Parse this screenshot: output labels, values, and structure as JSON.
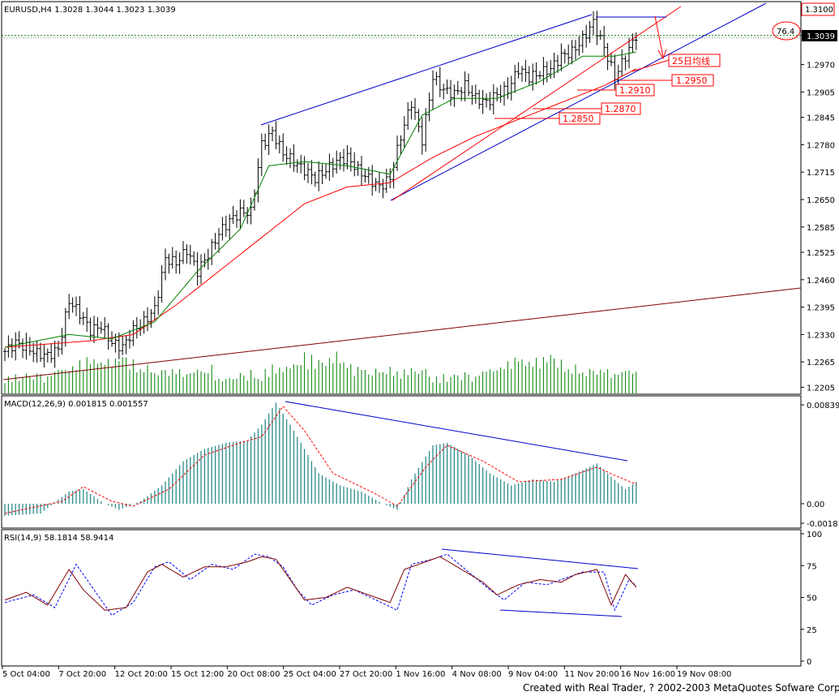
{
  "symbol_header": "EURUSD,H4 1.3028 1.3044 1.3023 1.3039",
  "macd_header": "MACD(12,26,9) 0.001815 0.001557",
  "rsi_header": "RSI(14,9) 58.1814 58.9414",
  "current_price": "1.3039",
  "high_box": "1.3100",
  "marker_value": "76.4",
  "footer": "Created with Real Trader, ? 2002-2003 MetaQuotes Sofware Corp.",
  "annotations": [
    {
      "text": "25日均线"
    },
    {
      "text": "1.2950"
    },
    {
      "text": "1.2910"
    },
    {
      "text": "1.2870"
    },
    {
      "text": "1.2850"
    }
  ],
  "colors": {
    "frame": "#000000",
    "bars": "#000000",
    "volume": "#008000",
    "ma_red": "#ff0000",
    "ma_green": "#008000",
    "channel_blue": "#0000cc",
    "trend_maroon": "#800000",
    "macd_hist": "#2e8b8b",
    "macd_signal": "#ff0000",
    "rsi_line": "#800000",
    "rsi_signal": "#0000ff",
    "annotation": "#ff0000"
  },
  "chart_data": [
    {
      "type": "candlestick",
      "title": "EURUSD,H4",
      "ohlc_last": {
        "open": 1.3028,
        "high": 1.3044,
        "low": 1.3023,
        "close": 1.3039
      },
      "y_ticks": [
        1.31,
        1.3039,
        1.297,
        1.2905,
        1.2845,
        1.278,
        1.2715,
        1.265,
        1.2585,
        1.2525,
        1.246,
        1.2395,
        1.233,
        1.2265,
        1.2205
      ],
      "ylim": [
        1.22,
        1.31
      ],
      "x_ticks": [
        "5 Oct 04:00",
        "7 Oct 20:00",
        "12 Oct 20:00",
        "15 Oct 12:00",
        "20 Oct 08:00",
        "25 Oct 04:00",
        "27 Oct 20:00",
        "1 Nov 16:00",
        "4 Nov 08:00",
        "9 Nov 04:00",
        "11 Nov 20:00",
        "16 Nov 16:00",
        "19 Nov 08:00"
      ],
      "close_path": [
        [
          0,
          1.229
        ],
        [
          3,
          1.231
        ],
        [
          6,
          1.23
        ],
        [
          9,
          1.2285
        ],
        [
          12,
          1.228
        ],
        [
          15,
          1.2295
        ],
        [
          18,
          1.241
        ],
        [
          21,
          1.238
        ],
        [
          24,
          1.234
        ],
        [
          27,
          1.235
        ],
        [
          30,
          1.231
        ],
        [
          33,
          1.23
        ],
        [
          36,
          1.234
        ],
        [
          39,
          1.236
        ],
        [
          42,
          1.239
        ],
        [
          45,
          1.251
        ],
        [
          48,
          1.25
        ],
        [
          51,
          1.253
        ],
        [
          54,
          1.248
        ],
        [
          57,
          1.252
        ],
        [
          60,
          1.257
        ],
        [
          63,
          1.26
        ],
        [
          66,
          1.262
        ],
        [
          69,
          1.262
        ],
        [
          72,
          1.278
        ],
        [
          75,
          1.281
        ],
        [
          78,
          1.276
        ],
        [
          81,
          1.274
        ],
        [
          84,
          1.272
        ],
        [
          87,
          1.27
        ],
        [
          90,
          1.272
        ],
        [
          93,
          1.274
        ],
        [
          96,
          1.275
        ],
        [
          99,
          1.272
        ],
        [
          102,
          1.27
        ],
        [
          105,
          1.268
        ],
        [
          108,
          1.27
        ],
        [
          111,
          1.28
        ],
        [
          114,
          1.288
        ],
        [
          117,
          1.279
        ],
        [
          120,
          1.294
        ],
        [
          123,
          1.291
        ],
        [
          126,
          1.29
        ],
        [
          129,
          1.292
        ],
        [
          132,
          1.289
        ],
        [
          135,
          1.288
        ],
        [
          138,
          1.29
        ],
        [
          141,
          1.291
        ],
        [
          144,
          1.296
        ],
        [
          147,
          1.294
        ],
        [
          150,
          1.295
        ],
        [
          153,
          1.296
        ],
        [
          156,
          1.299
        ],
        [
          159,
          1.3
        ],
        [
          162,
          1.303
        ],
        [
          165,
          1.307
        ],
        [
          168,
          1.301
        ],
        [
          171,
          1.294
        ],
        [
          174,
          1.299
        ],
        [
          177,
          1.3039
        ]
      ],
      "ma_red_path": [
        [
          0,
          1.23
        ],
        [
          24,
          1.2315
        ],
        [
          36,
          1.233
        ],
        [
          48,
          1.24
        ],
        [
          60,
          1.248
        ],
        [
          72,
          1.256
        ],
        [
          84,
          1.264
        ],
        [
          96,
          1.268
        ],
        [
          108,
          1.269
        ],
        [
          120,
          1.275
        ],
        [
          132,
          1.28
        ],
        [
          144,
          1.284
        ],
        [
          156,
          1.288
        ],
        [
          168,
          1.292
        ],
        [
          177,
          1.296
        ]
      ],
      "ma_green_path": [
        [
          0,
          1.23
        ],
        [
          18,
          1.233
        ],
        [
          30,
          1.232
        ],
        [
          42,
          1.236
        ],
        [
          54,
          1.248
        ],
        [
          66,
          1.258
        ],
        [
          74,
          1.273
        ],
        [
          84,
          1.274
        ],
        [
          96,
          1.273
        ],
        [
          108,
          1.271
        ],
        [
          117,
          1.285
        ],
        [
          126,
          1.289
        ],
        [
          138,
          1.289
        ],
        [
          150,
          1.293
        ],
        [
          162,
          1.299
        ],
        [
          171,
          1.299
        ],
        [
          177,
          1.3
        ]
      ],
      "volume_relative": [
        0.3,
        0.35,
        0.3,
        0.4,
        0.3,
        0.35,
        0.45,
        0.4,
        0.3,
        0.5,
        0.4,
        0.3,
        0.35,
        0.5,
        0.45,
        0.6,
        0.5,
        0.55,
        0.5,
        0.6,
        0.55,
        0.7,
        0.6,
        0.75,
        0.85,
        0.7,
        0.8,
        0.65,
        0.7,
        0.75,
        0.6,
        0.8,
        0.7,
        0.9,
        0.75,
        0.65,
        0.7,
        0.6,
        0.5,
        0.55,
        0.6,
        0.5,
        0.45,
        0.4,
        0.55,
        0.5,
        0.45,
        0.5,
        0.55,
        0.5,
        0.45,
        0.4,
        0.5,
        0.45,
        0.55,
        0.5,
        0.45,
        0.5,
        0.6,
        0.35
      ]
    },
    {
      "type": "bar",
      "title": "MACD(12,26,9)",
      "series": [
        {
          "name": "MACD"
        },
        {
          "name": "Signal"
        }
      ],
      "y_ticks": [
        "0.00839",
        "0.00",
        "-0.0018"
      ],
      "ylim": [
        -0.0018,
        0.00839
      ],
      "histogram_path": [
        [
          0,
          -0.001
        ],
        [
          10,
          -0.0008
        ],
        [
          18,
          0.001
        ],
        [
          22,
          0.0012
        ],
        [
          28,
          0.0
        ],
        [
          32,
          -0.0005
        ],
        [
          38,
          0.0002
        ],
        [
          44,
          0.0015
        ],
        [
          50,
          0.0035
        ],
        [
          56,
          0.0045
        ],
        [
          62,
          0.005
        ],
        [
          68,
          0.0052
        ],
        [
          72,
          0.0065
        ],
        [
          76,
          0.0083
        ],
        [
          80,
          0.0065
        ],
        [
          84,
          0.0045
        ],
        [
          88,
          0.0025
        ],
        [
          94,
          0.0015
        ],
        [
          100,
          0.001
        ],
        [
          106,
          0.0
        ],
        [
          110,
          -0.0005
        ],
        [
          114,
          0.002
        ],
        [
          120,
          0.0048
        ],
        [
          124,
          0.005
        ],
        [
          130,
          0.004
        ],
        [
          136,
          0.0025
        ],
        [
          142,
          0.0015
        ],
        [
          148,
          0.002
        ],
        [
          154,
          0.0018
        ],
        [
          160,
          0.0025
        ],
        [
          166,
          0.0033
        ],
        [
          170,
          0.0022
        ],
        [
          174,
          0.0012
        ],
        [
          177,
          0.0018
        ]
      ],
      "signal_path": [
        [
          0,
          -0.0008
        ],
        [
          16,
          0.0002
        ],
        [
          22,
          0.0014
        ],
        [
          30,
          0.0002
        ],
        [
          36,
          -0.0002
        ],
        [
          46,
          0.0012
        ],
        [
          56,
          0.004
        ],
        [
          66,
          0.005
        ],
        [
          72,
          0.0055
        ],
        [
          78,
          0.008
        ],
        [
          84,
          0.006
        ],
        [
          92,
          0.0025
        ],
        [
          104,
          0.0008
        ],
        [
          110,
          -0.0002
        ],
        [
          118,
          0.003
        ],
        [
          124,
          0.0048
        ],
        [
          134,
          0.0035
        ],
        [
          144,
          0.0018
        ],
        [
          156,
          0.002
        ],
        [
          166,
          0.003
        ],
        [
          172,
          0.0022
        ],
        [
          177,
          0.0016
        ]
      ]
    },
    {
      "type": "line",
      "title": "RSI(14,9)",
      "series": [
        {
          "name": "RSI"
        },
        {
          "name": "Signal"
        }
      ],
      "y_ticks": [
        100,
        75,
        50,
        25,
        0
      ],
      "ylim": [
        0,
        100
      ],
      "rsi_path": [
        [
          0,
          48
        ],
        [
          6,
          54
        ],
        [
          12,
          44
        ],
        [
          18,
          72
        ],
        [
          22,
          56
        ],
        [
          28,
          40
        ],
        [
          34,
          42
        ],
        [
          40,
          70
        ],
        [
          44,
          76
        ],
        [
          50,
          66
        ],
        [
          56,
          74
        ],
        [
          62,
          74
        ],
        [
          68,
          78
        ],
        [
          72,
          82
        ],
        [
          76,
          80
        ],
        [
          80,
          64
        ],
        [
          84,
          48
        ],
        [
          90,
          50
        ],
        [
          96,
          58
        ],
        [
          102,
          52
        ],
        [
          108,
          46
        ],
        [
          112,
          72
        ],
        [
          118,
          78
        ],
        [
          122,
          82
        ],
        [
          128,
          72
        ],
        [
          134,
          62
        ],
        [
          138,
          52
        ],
        [
          144,
          60
        ],
        [
          150,
          64
        ],
        [
          156,
          62
        ],
        [
          160,
          68
        ],
        [
          166,
          72
        ],
        [
          170,
          44
        ],
        [
          174,
          68
        ],
        [
          177,
          58
        ]
      ],
      "signal_path": [
        [
          0,
          46
        ],
        [
          8,
          52
        ],
        [
          14,
          42
        ],
        [
          20,
          76
        ],
        [
          26,
          52
        ],
        [
          30,
          36
        ],
        [
          36,
          46
        ],
        [
          42,
          74
        ],
        [
          46,
          78
        ],
        [
          52,
          64
        ],
        [
          58,
          76
        ],
        [
          64,
          72
        ],
        [
          70,
          84
        ],
        [
          74,
          82
        ],
        [
          78,
          74
        ],
        [
          82,
          56
        ],
        [
          86,
          44
        ],
        [
          92,
          52
        ],
        [
          98,
          56
        ],
        [
          104,
          48
        ],
        [
          110,
          40
        ],
        [
          114,
          76
        ],
        [
          120,
          80
        ],
        [
          124,
          84
        ],
        [
          130,
          70
        ],
        [
          136,
          56
        ],
        [
          140,
          48
        ],
        [
          146,
          62
        ],
        [
          152,
          60
        ],
        [
          158,
          66
        ],
        [
          162,
          70
        ],
        [
          168,
          70
        ],
        [
          171,
          40
        ],
        [
          175,
          64
        ],
        [
          177,
          59
        ]
      ]
    }
  ]
}
